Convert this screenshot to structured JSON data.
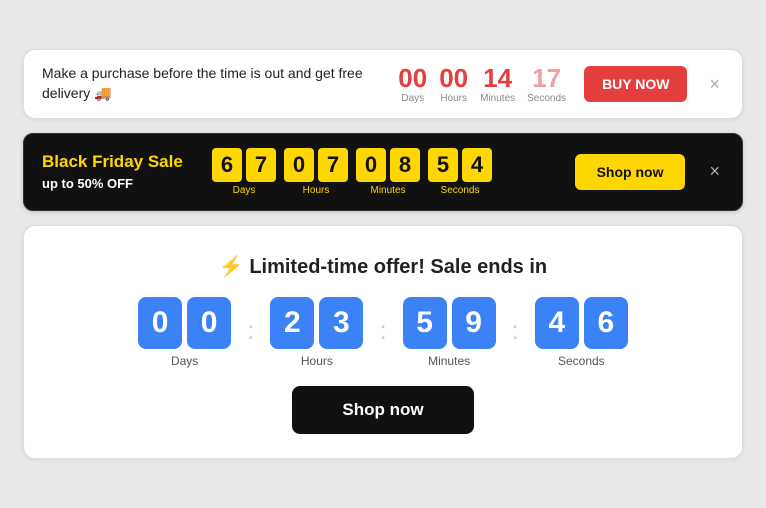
{
  "banner_delivery": {
    "text": "Make a purchase before the time is out and get free delivery 🚚",
    "countdown": {
      "days": {
        "value": "00",
        "label": "Days"
      },
      "hours": {
        "value": "00",
        "label": "Hours"
      },
      "minutes": {
        "value": "14",
        "label": "Minutes"
      },
      "seconds": {
        "value": "17",
        "label": "Seconds",
        "faded": true
      }
    },
    "buy_button": "BUY NOW",
    "close": "×"
  },
  "banner_blackfriday": {
    "title": "Black Friday Sale",
    "subtitle": "up to 50% OFF",
    "countdown": {
      "days": {
        "d1": "6",
        "d2": "7",
        "label": "Days"
      },
      "hours": {
        "d1": "0",
        "d2": "7",
        "label": "Hours"
      },
      "minutes": {
        "d1": "0",
        "d2": "8",
        "label": "Minutes"
      },
      "seconds": {
        "d1": "5",
        "d2": "4",
        "label": "Seconds"
      }
    },
    "shop_button": "Shop now",
    "close": "×"
  },
  "banner_limited": {
    "icon": "⚡",
    "title": "Limited-time offer! Sale ends in",
    "countdown": {
      "days": {
        "d1": "0",
        "d2": "0",
        "label": "Days"
      },
      "hours": {
        "d1": "2",
        "d2": "3",
        "label": "Hours"
      },
      "minutes": {
        "d1": "5",
        "d2": "9",
        "label": "Minutes"
      },
      "seconds": {
        "d1": "4",
        "d2": "6",
        "label": "Seconds"
      }
    },
    "shop_button": "Shop now"
  }
}
